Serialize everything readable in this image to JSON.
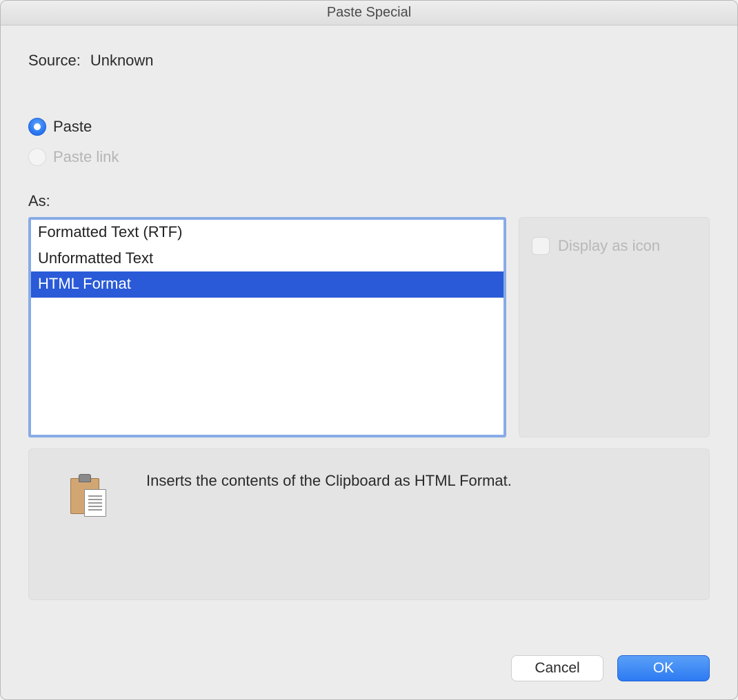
{
  "window": {
    "title": "Paste Special"
  },
  "source": {
    "label": "Source:",
    "value": "Unknown"
  },
  "radio": {
    "paste": "Paste",
    "paste_link": "Paste link",
    "selected": "paste",
    "paste_link_enabled": false
  },
  "as_label": "As:",
  "formats": {
    "items": [
      "Formatted Text (RTF)",
      "Unformatted Text",
      "HTML Format"
    ],
    "selected_index": 2
  },
  "display_as_icon": {
    "label": "Display as icon",
    "checked": false,
    "enabled": false
  },
  "info": {
    "text": "Inserts the contents of the Clipboard as HTML Format."
  },
  "buttons": {
    "cancel": "Cancel",
    "ok": "OK"
  }
}
